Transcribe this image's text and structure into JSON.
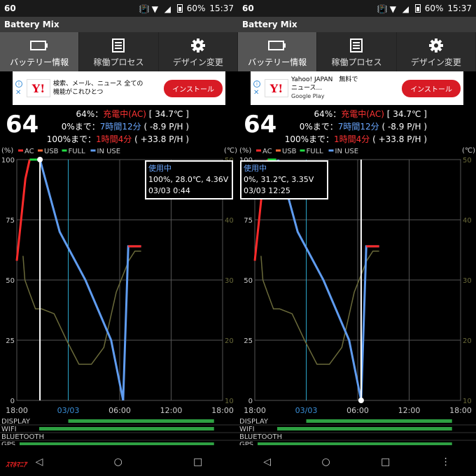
{
  "left": {
    "status": {
      "number": "60",
      "battery": "60%",
      "time": "15:37"
    },
    "app_title": "Battery Mix",
    "tabs": [
      {
        "label": "バッテリー情報"
      },
      {
        "label": "稼働プロセス"
      },
      {
        "label": "デザイン変更"
      }
    ],
    "ad": {
      "line1": "検索、メール、ニュース 全ての",
      "line2": "機能がこれひとつ",
      "gplay": "",
      "install": "インストール"
    },
    "big_pct": "64",
    "info": {
      "l1a": "64%：",
      "l1b": "充電中(AC)",
      "l1c": " [ 34.7℃ ]",
      "l2a": "0%まで：",
      "l2b": "7時間12分",
      "l2c": " ( -8.9 P/H )",
      "l3a": "100%まで：",
      "l3b": "1時間4分",
      "l3c": " ( +33.8 P/H )"
    },
    "tooltip": {
      "title": "使用中",
      "line1": "100%, 28.0℃, 4.36V",
      "line2": "03/03 0:44"
    }
  },
  "right": {
    "status": {
      "number": "60",
      "battery": "60%",
      "time": "15:37"
    },
    "app_title": "Battery Mix",
    "tabs": [
      {
        "label": "バッテリー情報"
      },
      {
        "label": "稼働プロセス"
      },
      {
        "label": "デザイン変更"
      }
    ],
    "ad": {
      "line1": "Yahoo! JAPAN　無料で",
      "line2": "ニュース...",
      "gplay": "Google Play",
      "install": "インストール"
    },
    "big_pct": "64",
    "info": {
      "l1a": "64%：",
      "l1b": "充電中(AC)",
      "l1c": " [ 34.7℃ ]",
      "l2a": "0%まで：",
      "l2b": "7時間12分",
      "l2c": " ( -8.9 P/H )",
      "l3a": "100%まで：",
      "l3b": "1時間4分",
      "l3c": " ( +33.8 P/H )"
    },
    "tooltip": {
      "title": "使用中",
      "line1": "0%, 31.2℃, 3.35V",
      "line2": "03/03 12:25"
    }
  },
  "legend": {
    "pct_unit": "(%)",
    "ac": "AC",
    "usb": "USB",
    "full": "FULL",
    "inuse": "IN USE",
    "temp_unit": "(℃)"
  },
  "rows": [
    "DISPLAY",
    "WIFI",
    "BLUETOOTH",
    "GPS"
  ],
  "colors": {
    "ac": "#ff2a2a",
    "usb": "#ff6a3a",
    "full": "#22dd44",
    "inuse": "#5f9cf0",
    "temp": "#6a6a3a",
    "grid": "#555555"
  },
  "chart_data": [
    {
      "type": "line",
      "ylim": [
        0,
        100
      ],
      "y2lim": [
        10,
        50
      ],
      "y_ticks": [
        "100",
        "75",
        "50",
        "25",
        "0"
      ],
      "y2_ticks": [
        "50",
        "40",
        "30",
        "20",
        "10"
      ],
      "x_ticks": [
        "18:00",
        "03/03",
        "06:00",
        "12:00",
        "18:00"
      ],
      "series": [
        {
          "name": "AC",
          "x_hours": [
            0,
            1,
            1.5
          ],
          "values": [
            58,
            92,
            100
          ]
        },
        {
          "name": "FULL",
          "x_hours": [
            1.5,
            2.5
          ],
          "values": [
            100,
            100
          ]
        },
        {
          "name": "IN USE",
          "x_hours": [
            2.7,
            5,
            8,
            11,
            12.4,
            13,
            14.5
          ],
          "values": [
            100,
            70,
            50,
            25,
            0,
            64,
            64
          ]
        },
        {
          "name": "AC",
          "x_hours": [
            13,
            14.5
          ],
          "values": [
            64,
            64
          ]
        }
      ],
      "selected_x_hours": 2.7
    },
    {
      "type": "line",
      "ylim": [
        0,
        100
      ],
      "y2lim": [
        10,
        50
      ],
      "y_ticks": [
        "100",
        "75",
        "50",
        "25",
        "0"
      ],
      "y2_ticks": [
        "50",
        "40",
        "30",
        "20",
        "10"
      ],
      "x_ticks": [
        "18:00",
        "03/03",
        "06:00",
        "12:00",
        "18:00"
      ],
      "series": [
        {
          "name": "AC",
          "x_hours": [
            0,
            1,
            1.5
          ],
          "values": [
            58,
            92,
            100
          ]
        },
        {
          "name": "FULL",
          "x_hours": [
            1.5,
            2.5
          ],
          "values": [
            100,
            100
          ]
        },
        {
          "name": "IN USE",
          "x_hours": [
            2.7,
            5,
            8,
            11,
            12.4,
            13,
            14.5
          ],
          "values": [
            100,
            70,
            50,
            25,
            0,
            64,
            64
          ]
        },
        {
          "name": "AC",
          "x_hours": [
            13,
            14.5
          ],
          "values": [
            64,
            64
          ]
        }
      ],
      "selected_x_hours": 12.4
    }
  ]
}
